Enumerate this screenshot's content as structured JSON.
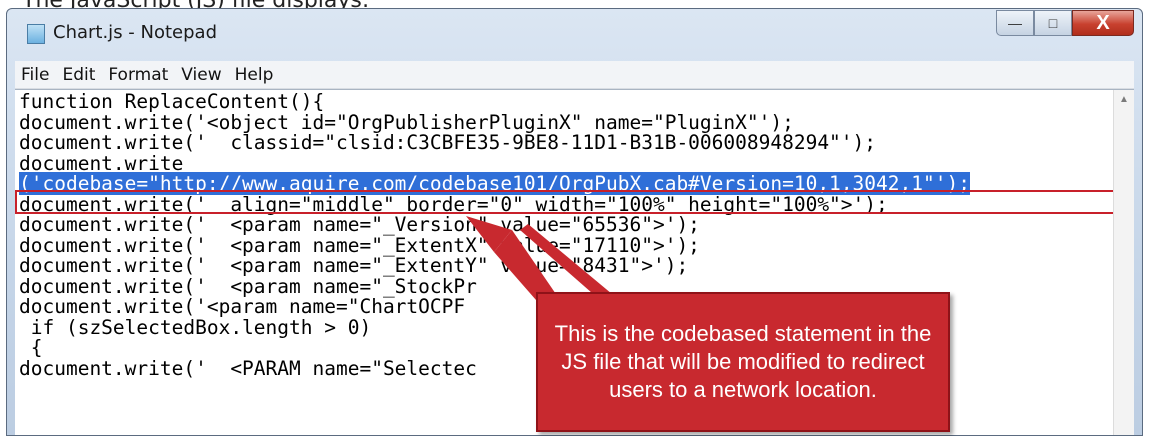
{
  "caption": "The JavaScript (JS) file displays:",
  "window": {
    "title": "Chart.js - Notepad",
    "controls": {
      "minimize": "—",
      "maximize": "□",
      "close": "X"
    }
  },
  "menu": [
    "File",
    "Edit",
    "Format",
    "View",
    "Help"
  ],
  "code_lines": [
    "function ReplaceContent(){",
    "document.write('<object id=\"OrgPublisherPluginX\" name=\"PluginX\"');",
    "document.write('  classid=\"clsid:C3CBFE35-9BE8-11D1-B31B-006008948294\"');",
    "document.write",
    "('codebase=\"http://www.aquire.com/codebase101/OrgPubX.cab#Version=10,1,3042,1\"');",
    "document.write('  align=\"middle\" border=\"0\" width=\"100%\" height=\"100%\">');",
    "document.write('  <param name=\"_Version\" value=\"65536\">');",
    "document.write('  <param name=\"_ExtentX\" value=\"17110\">');",
    "document.write('  <param name=\"_ExtentY\" value=\"8431\">');",
    "document.write('  <param name=\"_StockPr",
    "document.write('<param name=\"ChartOCPF",
    " if (szSelectedBox.length > 0)",
    " {",
    "document.write('  <PARAM name=\"Selectec"
  ],
  "highlighted_line_index": 4,
  "callout_text": "This is the codebased statement in the JS file that will be modified to redirect users to a network location.",
  "colors": {
    "callout": "#c8292f",
    "highlight": "#2f6fd8",
    "box": "#c8202a"
  }
}
